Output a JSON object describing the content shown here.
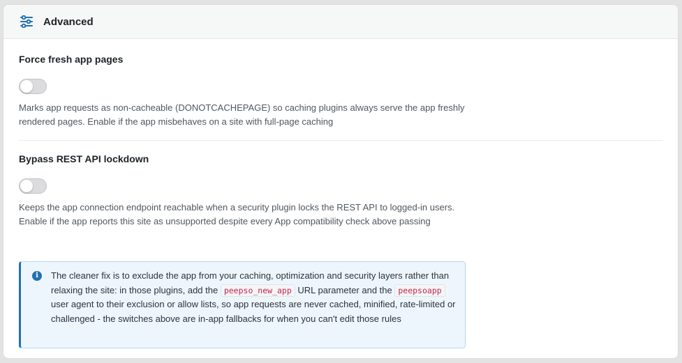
{
  "header": {
    "icon": "sliders-icon",
    "title": "Advanced"
  },
  "settings": [
    {
      "title": "Force fresh app pages",
      "enabled": false,
      "description": "Marks app requests as non-cacheable (DONOTCACHEPAGE) so caching plugins always serve the app freshly rendered pages. Enable if the app misbehaves on a site with full-page caching"
    },
    {
      "title": "Bypass REST API lockdown",
      "enabled": false,
      "description": "Keeps the app connection endpoint reachable when a security plugin locks the REST API to logged-in users. Enable if the app reports this site as unsupported despite every App compatibility check above passing"
    }
  ],
  "notice": {
    "icon": "info-icon",
    "text_1": "The cleaner fix is to exclude the app from your caching, optimization and security layers rather than relaxing the site: in those plugins, add the ",
    "code_1": "peepso_new_app",
    "text_2": " URL parameter and the ",
    "code_2": "peepsoapp",
    "text_3": " user agent to their exclusion or allow lists, so app requests are never cached, minified, rate-limited or challenged - the switches above are in-app fallbacks for when you can't edit those rules"
  },
  "colors": {
    "accent": "#2271b1",
    "code_text": "#c7254e",
    "toggle_off": "#dcdcde"
  }
}
